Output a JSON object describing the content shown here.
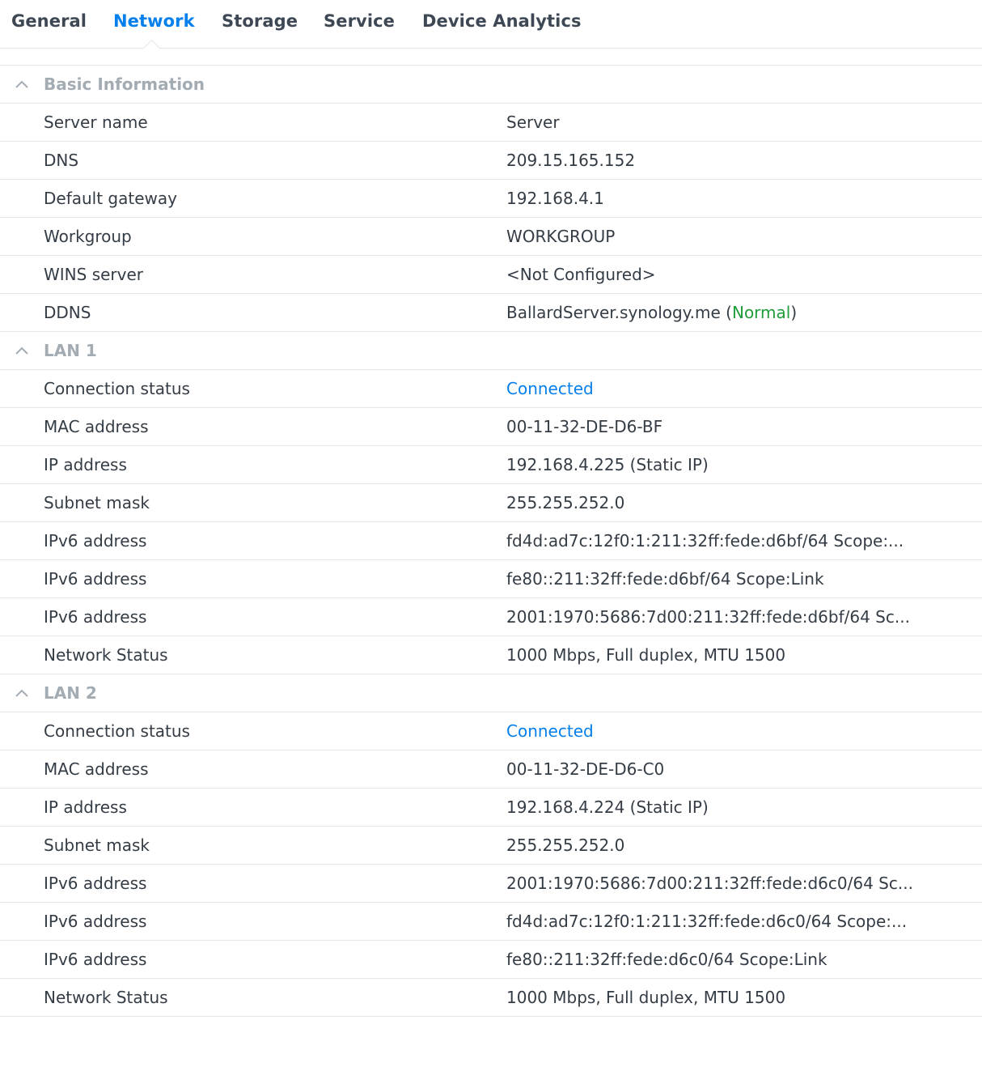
{
  "tabs": [
    {
      "label": "General",
      "active": false
    },
    {
      "label": "Network",
      "active": true
    },
    {
      "label": "Storage",
      "active": false
    },
    {
      "label": "Service",
      "active": false
    },
    {
      "label": "Device Analytics",
      "active": false
    }
  ],
  "colors": {
    "accent": "#057feb",
    "status_normal": "#1e9c3a",
    "section_header": "#a3abb3",
    "text": "#343c45",
    "border": "#e3e6ea"
  },
  "sections": [
    {
      "title": "Basic Information",
      "icon": "chevron-up-icon",
      "rows": [
        {
          "label": "Server name",
          "value": "Server"
        },
        {
          "label": "DNS",
          "value": "209.15.165.152"
        },
        {
          "label": "Default gateway",
          "value": "192.168.4.1"
        },
        {
          "label": "Workgroup",
          "value": "WORKGROUP"
        },
        {
          "label": "WINS server",
          "value": "<Not Configured>"
        },
        {
          "label": "DDNS",
          "value": "BallardServer.synology.me",
          "status": "Normal"
        }
      ]
    },
    {
      "title": "LAN 1",
      "icon": "chevron-up-icon",
      "rows": [
        {
          "label": "Connection status",
          "value": "Connected",
          "link": true
        },
        {
          "label": "MAC address",
          "value": "00-11-32-DE-D6-BF"
        },
        {
          "label": "IP address",
          "value": "192.168.4.225 (Static IP)"
        },
        {
          "label": "Subnet mask",
          "value": "255.255.252.0"
        },
        {
          "label": "IPv6 address",
          "value": "fd4d:ad7c:12f0:1:211:32ff:fede:d6bf/64 Scope:..."
        },
        {
          "label": "IPv6 address",
          "value": "fe80::211:32ff:fede:d6bf/64 Scope:Link"
        },
        {
          "label": "IPv6 address",
          "value": "2001:1970:5686:7d00:211:32ff:fede:d6bf/64 Sc..."
        },
        {
          "label": "Network Status",
          "value": "1000 Mbps, Full duplex, MTU 1500"
        }
      ]
    },
    {
      "title": "LAN 2",
      "icon": "chevron-up-icon",
      "rows": [
        {
          "label": "Connection status",
          "value": "Connected",
          "link": true
        },
        {
          "label": "MAC address",
          "value": "00-11-32-DE-D6-C0"
        },
        {
          "label": "IP address",
          "value": "192.168.4.224 (Static IP)"
        },
        {
          "label": "Subnet mask",
          "value": "255.255.252.0"
        },
        {
          "label": "IPv6 address",
          "value": "2001:1970:5686:7d00:211:32ff:fede:d6c0/64 Sc..."
        },
        {
          "label": "IPv6 address",
          "value": "fd4d:ad7c:12f0:1:211:32ff:fede:d6c0/64 Scope:..."
        },
        {
          "label": "IPv6 address",
          "value": "fe80::211:32ff:fede:d6c0/64 Scope:Link"
        },
        {
          "label": "Network Status",
          "value": "1000 Mbps, Full duplex, MTU 1500"
        }
      ]
    }
  ]
}
